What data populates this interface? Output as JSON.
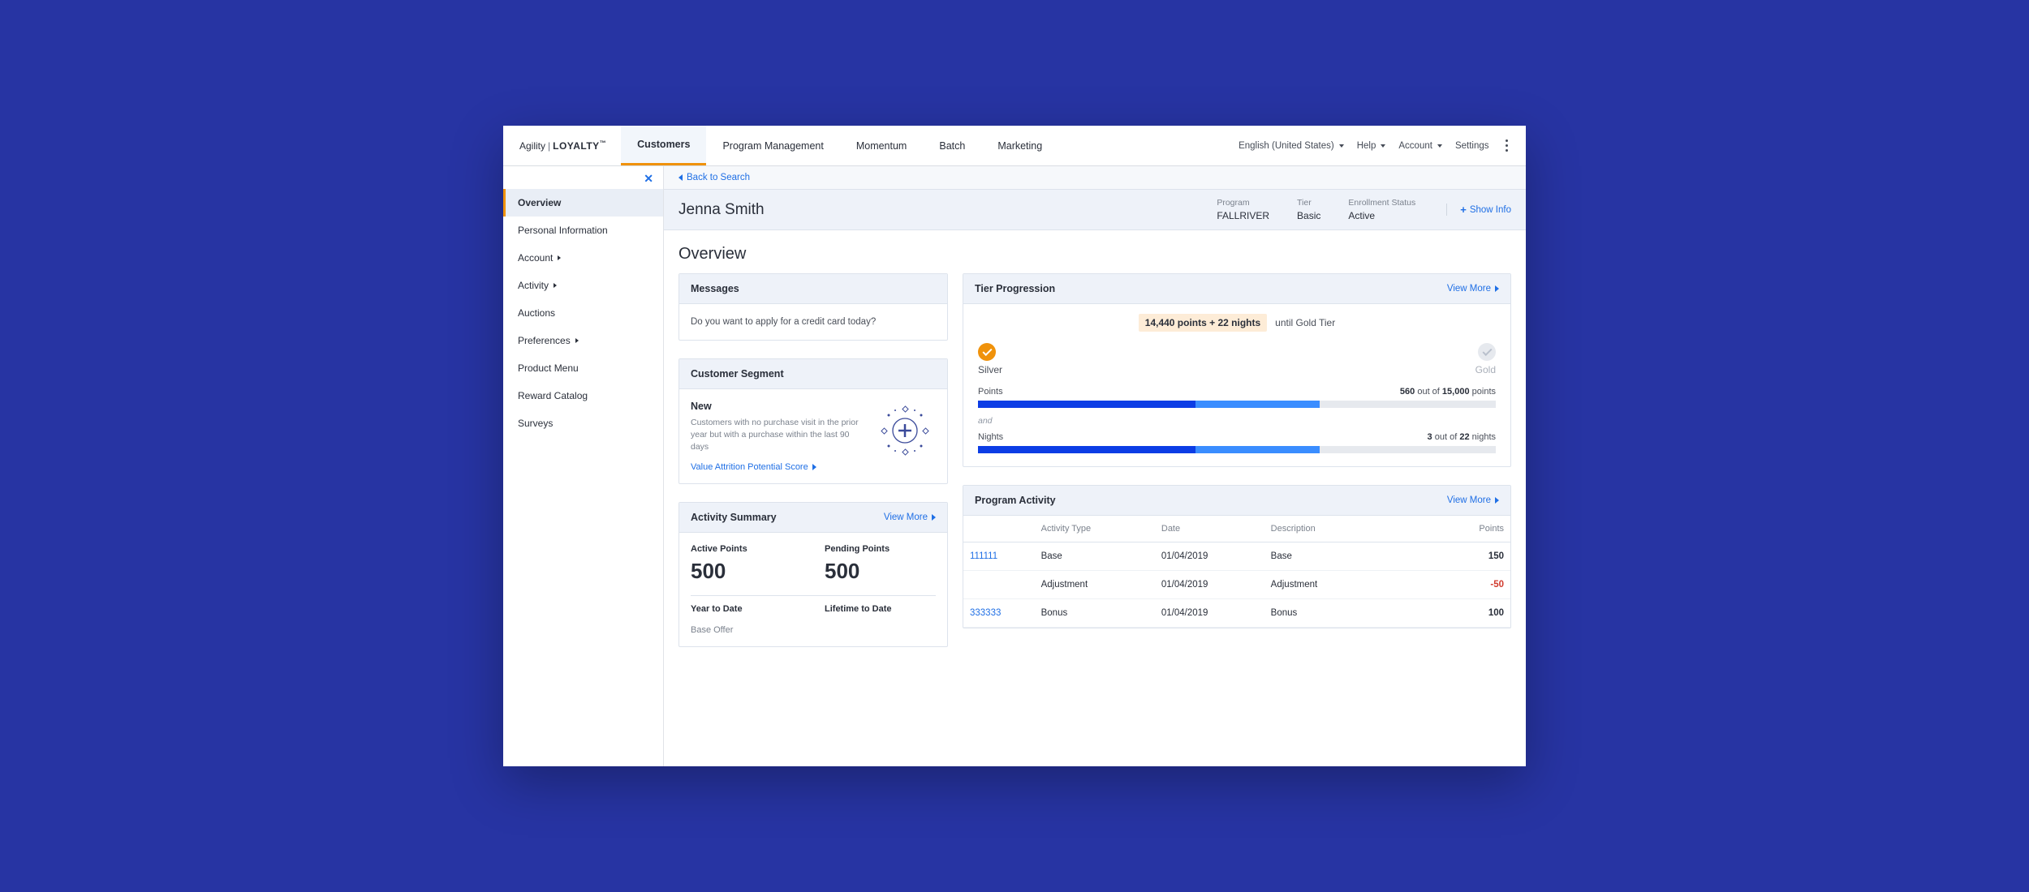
{
  "brand": {
    "line1": "Agility",
    "line2": "LOYALTY"
  },
  "nav": {
    "items": [
      "Customers",
      "Program Management",
      "Momentum",
      "Batch",
      "Marketing"
    ],
    "active": 0
  },
  "topright": {
    "lang": "English (United States)",
    "help": "Help",
    "account": "Account",
    "settings": "Settings"
  },
  "sidebar": {
    "items": [
      {
        "label": "Overview",
        "expandable": false,
        "active": true
      },
      {
        "label": "Personal Information",
        "expandable": false
      },
      {
        "label": "Account",
        "expandable": true
      },
      {
        "label": "Activity",
        "expandable": true
      },
      {
        "label": "Auctions",
        "expandable": false
      },
      {
        "label": "Preferences",
        "expandable": true
      },
      {
        "label": "Product Menu",
        "expandable": false
      },
      {
        "label": "Reward Catalog",
        "expandable": false
      },
      {
        "label": "Surveys",
        "expandable": false
      }
    ]
  },
  "back_link": "Back to Search",
  "customer": {
    "name": "Jenna Smith",
    "meta": [
      {
        "label": "Program",
        "value": "FALLRIVER"
      },
      {
        "label": "Tier",
        "value": "Basic"
      },
      {
        "label": "Enrollment Status",
        "value": "Active"
      }
    ],
    "show_info": "Show Info"
  },
  "page_title": "Overview",
  "messages": {
    "title": "Messages",
    "body": "Do you want to apply for a credit card today?"
  },
  "segment": {
    "title": "Customer Segment",
    "name": "New",
    "desc": "Customers with no purchase visit in the prior year but with a purchase within the last 90 days",
    "link": "Value Attrition Potential Score"
  },
  "activity_summary": {
    "title": "Activity Summary",
    "view_more": "View More",
    "active_label": "Active Points",
    "active_value": "500",
    "pending_label": "Pending Points",
    "pending_value": "500",
    "ytd": "Year to Date",
    "ltd": "Lifetime to Date",
    "sub": "Base Offer"
  },
  "tier": {
    "title": "Tier Progression",
    "view_more": "View More",
    "headline_points": "14,440 points + 22 nights",
    "headline_suffix": "until Gold Tier",
    "from": "Silver",
    "to": "Gold",
    "points": {
      "label": "Points",
      "current": "560",
      "out_of": "out of",
      "total": "15,000",
      "unit": "points",
      "pct_light": 66,
      "pct_dark": 42
    },
    "and": "and",
    "nights": {
      "label": "Nights",
      "current": "3",
      "out_of": "out of",
      "total": "22",
      "unit": "nights",
      "pct_light": 66,
      "pct_dark": 42
    }
  },
  "program_activity": {
    "title": "Program Activity",
    "view_more": "View More",
    "headers": [
      "",
      "Activity Type",
      "Date",
      "Description",
      "Points"
    ],
    "rows": [
      {
        "id": "111111",
        "type": "Base",
        "date": "01/04/2019",
        "desc": "Base",
        "points": "150",
        "neg": false
      },
      {
        "id": "",
        "type": "Adjustment",
        "date": "01/04/2019",
        "desc": "Adjustment",
        "points": "-50",
        "neg": true
      },
      {
        "id": "333333",
        "type": "Bonus",
        "date": "01/04/2019",
        "desc": "Bonus",
        "points": "100",
        "neg": false
      }
    ]
  }
}
